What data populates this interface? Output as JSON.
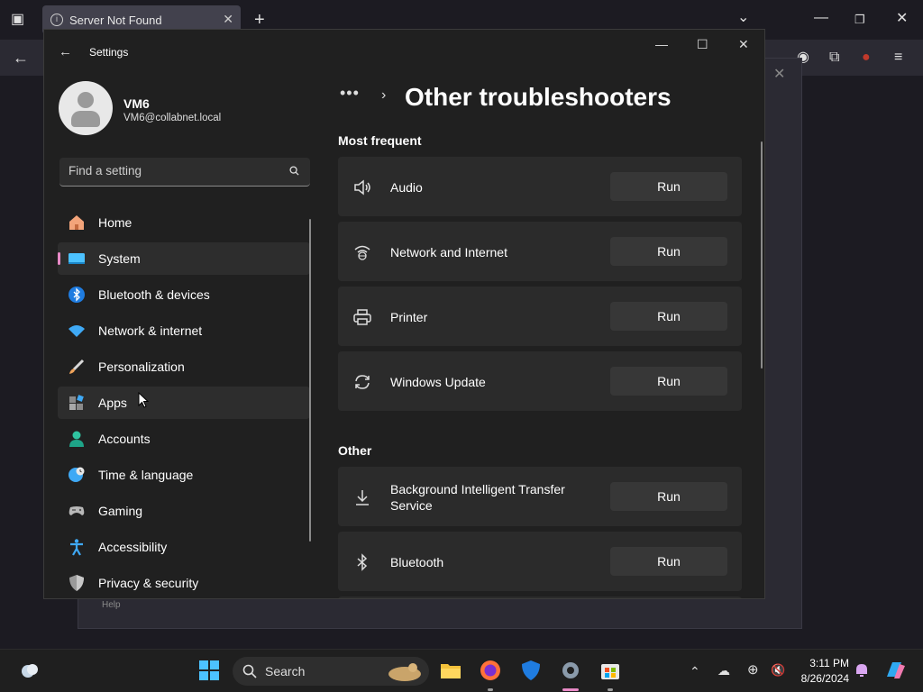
{
  "browser": {
    "tab_title": "Server Not Found",
    "dialog_help": "Help"
  },
  "settings": {
    "window_title": "Settings",
    "user": {
      "name": "VM6",
      "email": "VM6@collabnet.local"
    },
    "search_placeholder": "Find a setting",
    "nav": [
      {
        "label": "Home",
        "icon": "home-icon"
      },
      {
        "label": "System",
        "icon": "system-icon",
        "selected": true
      },
      {
        "label": "Bluetooth & devices",
        "icon": "bluetooth-devices-icon"
      },
      {
        "label": "Network & internet",
        "icon": "network-icon"
      },
      {
        "label": "Personalization",
        "icon": "brush-icon"
      },
      {
        "label": "Apps",
        "icon": "apps-icon",
        "hovered": true
      },
      {
        "label": "Accounts",
        "icon": "accounts-icon"
      },
      {
        "label": "Time & language",
        "icon": "globe-clock-icon"
      },
      {
        "label": "Gaming",
        "icon": "gamepad-icon"
      },
      {
        "label": "Accessibility",
        "icon": "accessibility-icon"
      },
      {
        "label": "Privacy & security",
        "icon": "shield-icon"
      }
    ],
    "breadcrumb_more": "•••",
    "page_title": "Other troubleshooters",
    "sections": [
      {
        "heading": "Most frequent",
        "items": [
          {
            "label": "Audio",
            "icon": "speaker-icon",
            "button": "Run"
          },
          {
            "label": "Network and Internet",
            "icon": "network-globe-icon",
            "button": "Run"
          },
          {
            "label": "Printer",
            "icon": "printer-icon",
            "button": "Run"
          },
          {
            "label": "Windows Update",
            "icon": "sync-icon",
            "button": "Run"
          }
        ]
      },
      {
        "heading": "Other",
        "items": [
          {
            "label": "Background Intelligent Transfer Service",
            "icon": "download-icon",
            "button": "Run"
          },
          {
            "label": "Bluetooth",
            "icon": "bluetooth-icon",
            "button": "Run"
          }
        ]
      }
    ]
  },
  "taskbar": {
    "search_label": "Search",
    "time": "3:11 PM",
    "date": "8/26/2024"
  }
}
